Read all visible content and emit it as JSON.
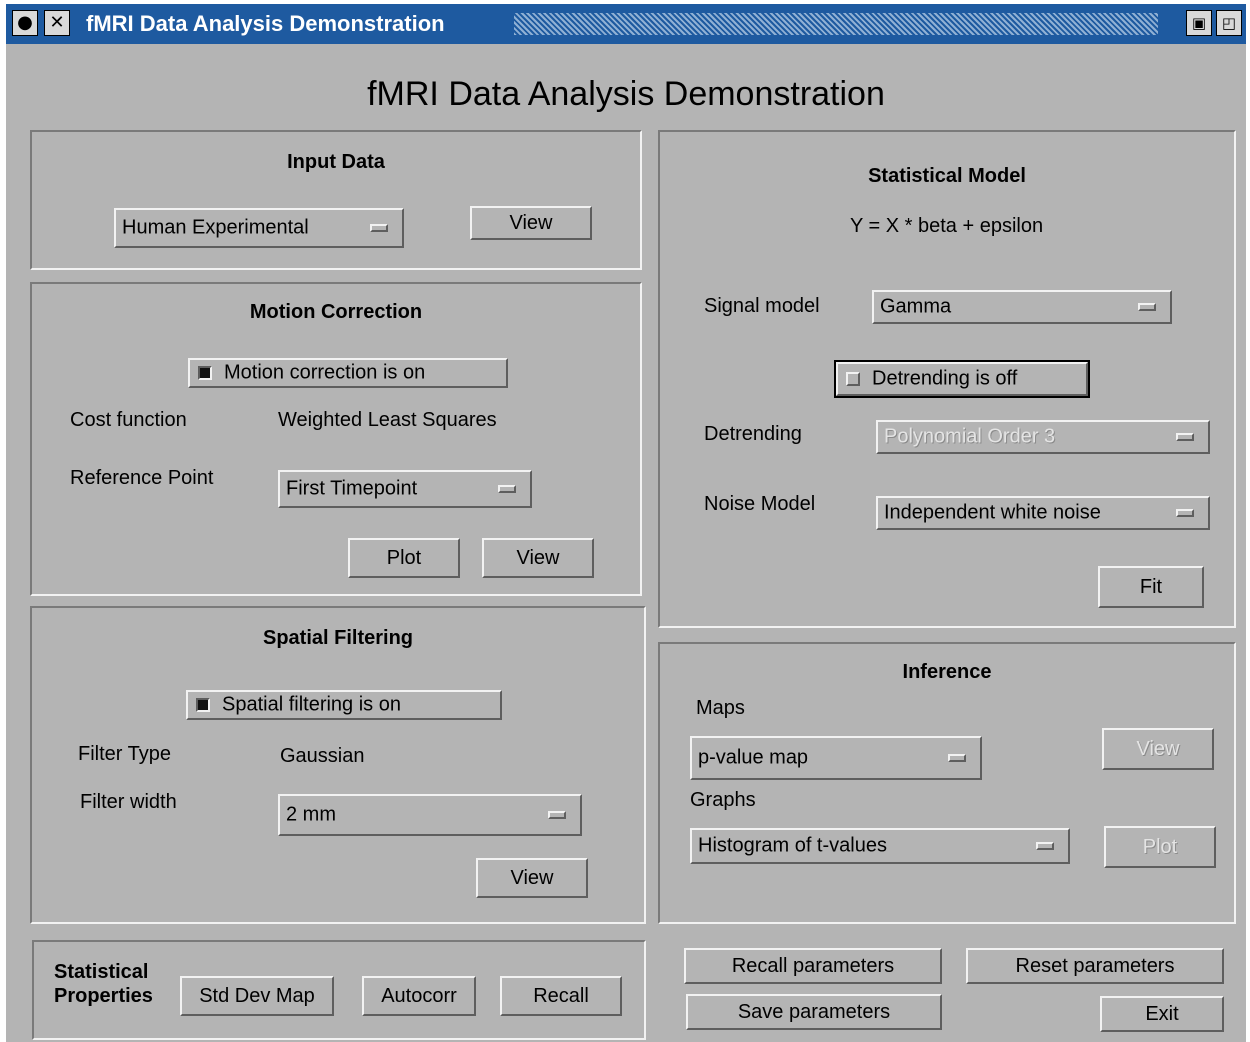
{
  "window": {
    "title": "fMRI Data Analysis Demonstration"
  },
  "app_title": "fMRI Data Analysis Demonstration",
  "input_data": {
    "title": "Input Data",
    "dataset": "Human Experimental",
    "view_label": "View"
  },
  "motion_correction": {
    "title": "Motion Correction",
    "toggle_label": "Motion correction is on",
    "toggle_on": true,
    "cost_function_label": "Cost function",
    "cost_function_value": "Weighted Least Squares",
    "reference_point_label": "Reference Point",
    "reference_point_value": "First Timepoint",
    "plot_label": "Plot",
    "view_label": "View"
  },
  "spatial_filtering": {
    "title": "Spatial Filtering",
    "toggle_label": "Spatial filtering is on",
    "toggle_on": true,
    "filter_type_label": "Filter Type",
    "filter_type_value": "Gaussian",
    "filter_width_label": "Filter width",
    "filter_width_value": "2 mm",
    "view_label": "View"
  },
  "statistical_model": {
    "title": "Statistical Model",
    "equation": "Y = X * beta + epsilon",
    "signal_model_label": "Signal model",
    "signal_model_value": "Gamma",
    "detrending_toggle_label": "Detrending is off",
    "detrending_toggle_on": false,
    "detrending_label": "Detrending",
    "detrending_value": "Polynomial Order 3",
    "noise_model_label": "Noise Model",
    "noise_model_value": "Independent white noise",
    "fit_label": "Fit"
  },
  "inference": {
    "title": "Inference",
    "maps_label": "Maps",
    "maps_value": "p-value map",
    "maps_view_label": "View",
    "graphs_label": "Graphs",
    "graphs_value": "Histogram of t-values",
    "graphs_plot_label": "Plot"
  },
  "statistical_properties": {
    "title_line1": "Statistical",
    "title_line2": "Properties",
    "std_dev_map_label": "Std Dev Map",
    "autocorr_label": "Autocorr",
    "recall_label": "Recall"
  },
  "actions": {
    "recall_parameters": "Recall parameters",
    "reset_parameters": "Reset parameters",
    "save_parameters": "Save parameters",
    "exit": "Exit"
  },
  "colors": {
    "background": "#b4b4b4",
    "titlebar": "#1e5aa0",
    "title_text": "#ffffff"
  }
}
